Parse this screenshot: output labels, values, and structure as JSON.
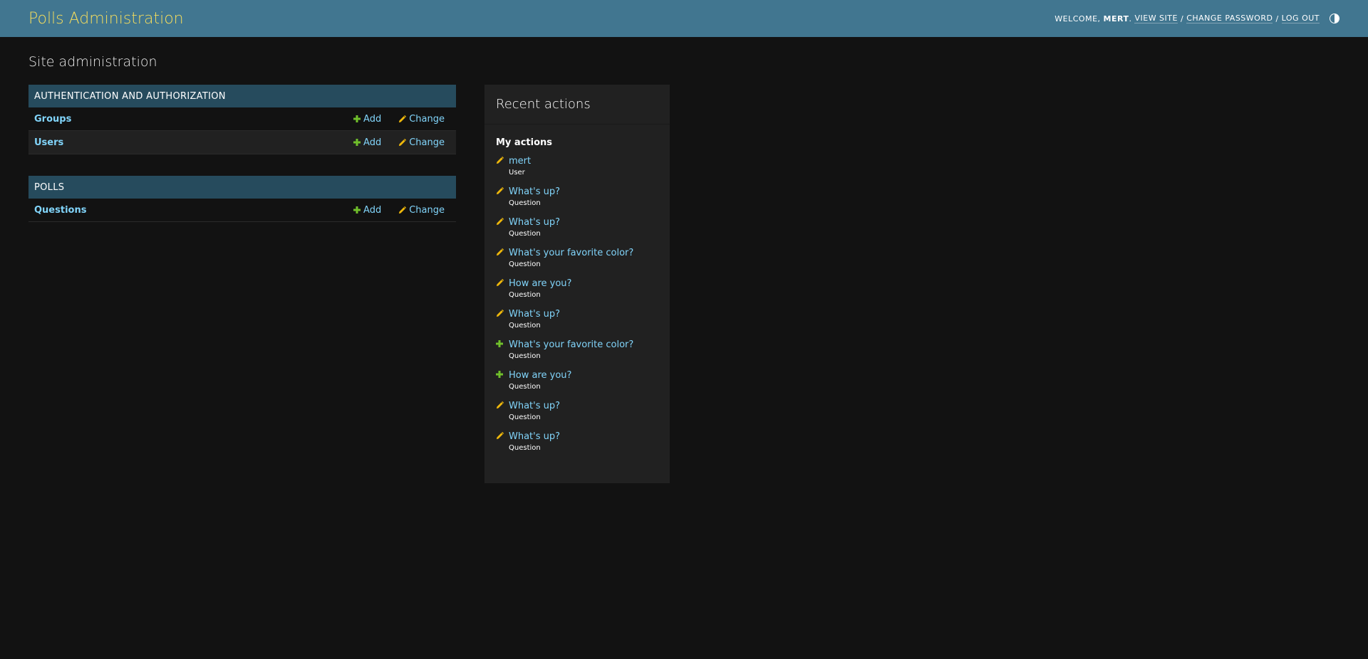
{
  "header": {
    "branding": "Polls Administration",
    "welcome": "Welcome,",
    "username": "mert",
    "view_site": "View site",
    "change_password": "Change password",
    "log_out": "Log out",
    "sep": "/"
  },
  "page_title": "Site administration",
  "modules": [
    {
      "caption": "Authentication and Authorization",
      "models": [
        {
          "name": "Groups",
          "add": "Add",
          "change": "Change"
        },
        {
          "name": "Users",
          "add": "Add",
          "change": "Change"
        }
      ]
    },
    {
      "caption": "Polls",
      "models": [
        {
          "name": "Questions",
          "add": "Add",
          "change": "Change"
        }
      ]
    }
  ],
  "recent": {
    "title": "Recent actions",
    "subtitle": "My actions",
    "actions": [
      {
        "type": "change",
        "object": "mert",
        "content_type": "User"
      },
      {
        "type": "change",
        "object": "What's up?",
        "content_type": "Question"
      },
      {
        "type": "change",
        "object": "What's up?",
        "content_type": "Question"
      },
      {
        "type": "change",
        "object": "What's your favorite color?",
        "content_type": "Question"
      },
      {
        "type": "change",
        "object": "How are you?",
        "content_type": "Question"
      },
      {
        "type": "change",
        "object": "What's up?",
        "content_type": "Question"
      },
      {
        "type": "add",
        "object": "What's your favorite color?",
        "content_type": "Question"
      },
      {
        "type": "add",
        "object": "How are you?",
        "content_type": "Question"
      },
      {
        "type": "change",
        "object": "What's up?",
        "content_type": "Question"
      },
      {
        "type": "change",
        "object": "What's up?",
        "content_type": "Question"
      }
    ]
  },
  "colors": {
    "header_bg": "#417690",
    "branding": "#f5dd5d",
    "caption_bg": "#264b5d",
    "link": "#81d4fa",
    "add_icon": "#70bf2b",
    "change_icon": "#efb80b"
  },
  "icons": {
    "add": "plus-icon",
    "change": "pencil-icon",
    "theme": "contrast-icon"
  }
}
